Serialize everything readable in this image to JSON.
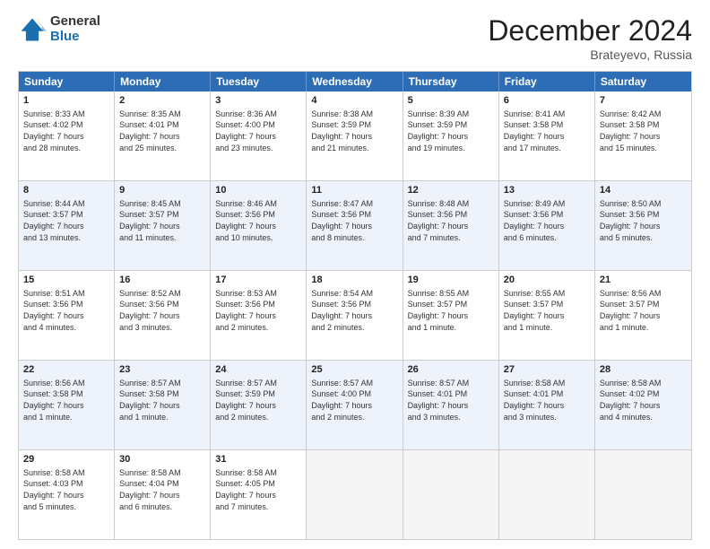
{
  "header": {
    "logo_line1": "General",
    "logo_line2": "Blue",
    "month": "December 2024",
    "location": "Brateyevo, Russia"
  },
  "weekdays": [
    "Sunday",
    "Monday",
    "Tuesday",
    "Wednesday",
    "Thursday",
    "Friday",
    "Saturday"
  ],
  "rows": [
    {
      "alt": false,
      "cells": [
        {
          "day": "1",
          "lines": [
            "Sunrise: 8:33 AM",
            "Sunset: 4:02 PM",
            "Daylight: 7 hours",
            "and 28 minutes."
          ]
        },
        {
          "day": "2",
          "lines": [
            "Sunrise: 8:35 AM",
            "Sunset: 4:01 PM",
            "Daylight: 7 hours",
            "and 25 minutes."
          ]
        },
        {
          "day": "3",
          "lines": [
            "Sunrise: 8:36 AM",
            "Sunset: 4:00 PM",
            "Daylight: 7 hours",
            "and 23 minutes."
          ]
        },
        {
          "day": "4",
          "lines": [
            "Sunrise: 8:38 AM",
            "Sunset: 3:59 PM",
            "Daylight: 7 hours",
            "and 21 minutes."
          ]
        },
        {
          "day": "5",
          "lines": [
            "Sunrise: 8:39 AM",
            "Sunset: 3:59 PM",
            "Daylight: 7 hours",
            "and 19 minutes."
          ]
        },
        {
          "day": "6",
          "lines": [
            "Sunrise: 8:41 AM",
            "Sunset: 3:58 PM",
            "Daylight: 7 hours",
            "and 17 minutes."
          ]
        },
        {
          "day": "7",
          "lines": [
            "Sunrise: 8:42 AM",
            "Sunset: 3:58 PM",
            "Daylight: 7 hours",
            "and 15 minutes."
          ]
        }
      ]
    },
    {
      "alt": true,
      "cells": [
        {
          "day": "8",
          "lines": [
            "Sunrise: 8:44 AM",
            "Sunset: 3:57 PM",
            "Daylight: 7 hours",
            "and 13 minutes."
          ]
        },
        {
          "day": "9",
          "lines": [
            "Sunrise: 8:45 AM",
            "Sunset: 3:57 PM",
            "Daylight: 7 hours",
            "and 11 minutes."
          ]
        },
        {
          "day": "10",
          "lines": [
            "Sunrise: 8:46 AM",
            "Sunset: 3:56 PM",
            "Daylight: 7 hours",
            "and 10 minutes."
          ]
        },
        {
          "day": "11",
          "lines": [
            "Sunrise: 8:47 AM",
            "Sunset: 3:56 PM",
            "Daylight: 7 hours",
            "and 8 minutes."
          ]
        },
        {
          "day": "12",
          "lines": [
            "Sunrise: 8:48 AM",
            "Sunset: 3:56 PM",
            "Daylight: 7 hours",
            "and 7 minutes."
          ]
        },
        {
          "day": "13",
          "lines": [
            "Sunrise: 8:49 AM",
            "Sunset: 3:56 PM",
            "Daylight: 7 hours",
            "and 6 minutes."
          ]
        },
        {
          "day": "14",
          "lines": [
            "Sunrise: 8:50 AM",
            "Sunset: 3:56 PM",
            "Daylight: 7 hours",
            "and 5 minutes."
          ]
        }
      ]
    },
    {
      "alt": false,
      "cells": [
        {
          "day": "15",
          "lines": [
            "Sunrise: 8:51 AM",
            "Sunset: 3:56 PM",
            "Daylight: 7 hours",
            "and 4 minutes."
          ]
        },
        {
          "day": "16",
          "lines": [
            "Sunrise: 8:52 AM",
            "Sunset: 3:56 PM",
            "Daylight: 7 hours",
            "and 3 minutes."
          ]
        },
        {
          "day": "17",
          "lines": [
            "Sunrise: 8:53 AM",
            "Sunset: 3:56 PM",
            "Daylight: 7 hours",
            "and 2 minutes."
          ]
        },
        {
          "day": "18",
          "lines": [
            "Sunrise: 8:54 AM",
            "Sunset: 3:56 PM",
            "Daylight: 7 hours",
            "and 2 minutes."
          ]
        },
        {
          "day": "19",
          "lines": [
            "Sunrise: 8:55 AM",
            "Sunset: 3:57 PM",
            "Daylight: 7 hours",
            "and 1 minute."
          ]
        },
        {
          "day": "20",
          "lines": [
            "Sunrise: 8:55 AM",
            "Sunset: 3:57 PM",
            "Daylight: 7 hours",
            "and 1 minute."
          ]
        },
        {
          "day": "21",
          "lines": [
            "Sunrise: 8:56 AM",
            "Sunset: 3:57 PM",
            "Daylight: 7 hours",
            "and 1 minute."
          ]
        }
      ]
    },
    {
      "alt": true,
      "cells": [
        {
          "day": "22",
          "lines": [
            "Sunrise: 8:56 AM",
            "Sunset: 3:58 PM",
            "Daylight: 7 hours",
            "and 1 minute."
          ]
        },
        {
          "day": "23",
          "lines": [
            "Sunrise: 8:57 AM",
            "Sunset: 3:58 PM",
            "Daylight: 7 hours",
            "and 1 minute."
          ]
        },
        {
          "day": "24",
          "lines": [
            "Sunrise: 8:57 AM",
            "Sunset: 3:59 PM",
            "Daylight: 7 hours",
            "and 2 minutes."
          ]
        },
        {
          "day": "25",
          "lines": [
            "Sunrise: 8:57 AM",
            "Sunset: 4:00 PM",
            "Daylight: 7 hours",
            "and 2 minutes."
          ]
        },
        {
          "day": "26",
          "lines": [
            "Sunrise: 8:57 AM",
            "Sunset: 4:01 PM",
            "Daylight: 7 hours",
            "and 3 minutes."
          ]
        },
        {
          "day": "27",
          "lines": [
            "Sunrise: 8:58 AM",
            "Sunset: 4:01 PM",
            "Daylight: 7 hours",
            "and 3 minutes."
          ]
        },
        {
          "day": "28",
          "lines": [
            "Sunrise: 8:58 AM",
            "Sunset: 4:02 PM",
            "Daylight: 7 hours",
            "and 4 minutes."
          ]
        }
      ]
    },
    {
      "alt": false,
      "cells": [
        {
          "day": "29",
          "lines": [
            "Sunrise: 8:58 AM",
            "Sunset: 4:03 PM",
            "Daylight: 7 hours",
            "and 5 minutes."
          ]
        },
        {
          "day": "30",
          "lines": [
            "Sunrise: 8:58 AM",
            "Sunset: 4:04 PM",
            "Daylight: 7 hours",
            "and 6 minutes."
          ]
        },
        {
          "day": "31",
          "lines": [
            "Sunrise: 8:58 AM",
            "Sunset: 4:05 PM",
            "Daylight: 7 hours",
            "and 7 minutes."
          ]
        },
        {
          "day": "",
          "lines": []
        },
        {
          "day": "",
          "lines": []
        },
        {
          "day": "",
          "lines": []
        },
        {
          "day": "",
          "lines": []
        }
      ]
    }
  ]
}
